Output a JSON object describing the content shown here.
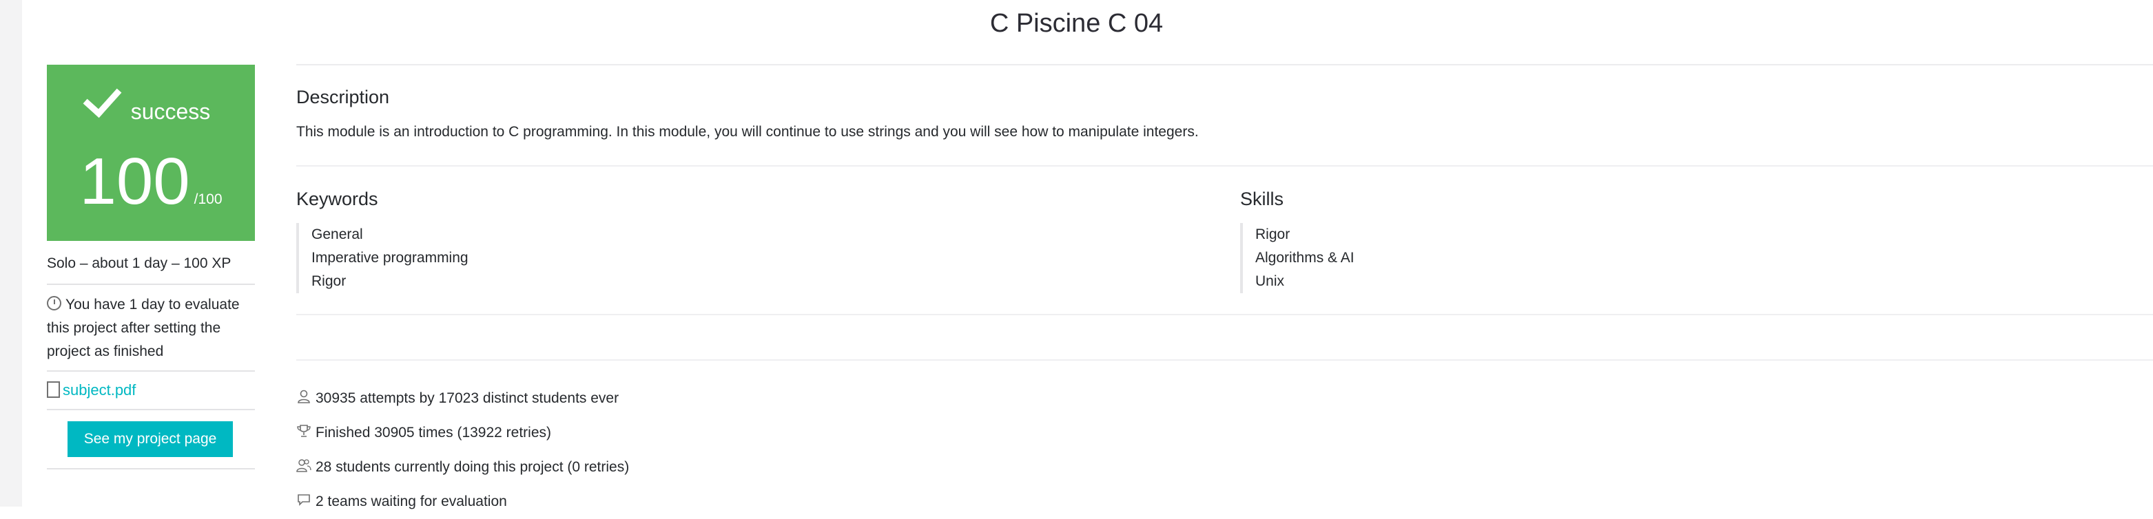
{
  "page": {
    "title": "C Piscine C 04"
  },
  "sidebar": {
    "status": {
      "label": "success",
      "icon": "check-icon"
    },
    "score": {
      "value": "100",
      "max": "/100"
    },
    "meta": "Solo – about 1 day – 100 XP",
    "evaluation_notice": "You have 1 day to evaluate this project after setting the project as finished",
    "subject": {
      "label": "subject.pdf",
      "icon": "document-icon"
    },
    "project_button": "See my project page"
  },
  "main": {
    "description": {
      "heading": "Description",
      "text": "This module is an introduction to C programming. In this module, you will continue to use strings and you will see how to manipulate integers."
    },
    "keywords": {
      "heading": "Keywords",
      "items": [
        "General",
        "Imperative programming",
        "Rigor"
      ]
    },
    "skills": {
      "heading": "Skills",
      "items": [
        "Rigor",
        "Algorithms & AI",
        "Unix"
      ]
    },
    "stats": [
      {
        "icon": "user-icon",
        "text": "30935 attempts by 17023 distinct students ever"
      },
      {
        "icon": "trophy-icon",
        "text": "Finished 30905 times (13922 retries)"
      },
      {
        "icon": "users-icon",
        "text": "28 students currently doing this project (0 retries)"
      },
      {
        "icon": "chat-bubble-icon",
        "text": "2 teams waiting for evaluation"
      }
    ]
  },
  "colors": {
    "success": "#5cb85c",
    "accent": "#00b8c2",
    "text": "#26292d"
  }
}
